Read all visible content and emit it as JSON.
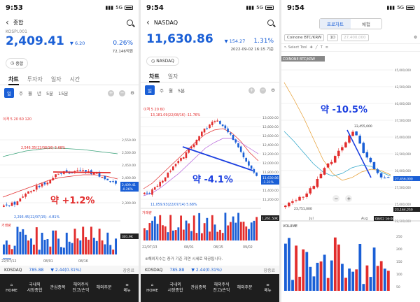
{
  "colors": {
    "up": "#e22d2d",
    "down": "#1a5fd6",
    "trend": "#1b3fe0"
  },
  "panel1": {
    "time": "9:53",
    "network": "5G",
    "title": "종합",
    "code": "KOSPI.001",
    "price": "2,409.41",
    "change": "▼ 6.20",
    "change_pct": "0.26%",
    "volume": "72,146억원",
    "chip": "종합",
    "tabs": [
      "차트",
      "투자자",
      "일자",
      "시간"
    ],
    "periods": [
      "일",
      "주",
      "월",
      "년",
      "5분",
      "15분"
    ],
    "legend": "이격 5 20 60 120",
    "high_label": "2,546.35(22/08/16) 5.68%",
    "low_label": "2,293.45(22/07/15) -4.81%",
    "current_tag": "2,409.41",
    "current_pct": "-0.26%",
    "vol_tag": "301.9K",
    "vol_label": "거래량",
    "price_axis": [
      "2,550.00",
      "2,500.00",
      "2,450.00",
      "2,400.00",
      "2,350.00",
      "2,300.00"
    ],
    "dates": [
      "22/07/12",
      "08/01",
      "08/16"
    ],
    "annotation": "약 +1.2%",
    "ticker": {
      "name": "KOSDAQ",
      "value": "785.88",
      "chg": "▼ 2.44(0.31%)",
      "more": "장종료"
    },
    "nav": [
      "HOME",
      "국내외\n시장종합",
      "관심종목",
      "해외주식\n잔고/손익",
      "해외주문",
      "메뉴"
    ]
  },
  "panel2": {
    "time": "9:54",
    "network": "5G",
    "title": "NASDAQ",
    "price": "11,630.86",
    "change": "▼ 154.27",
    "change_pct": "1.31%",
    "datetime": "2022-09-02 16:15 기준",
    "chip": "NASDAQ",
    "tabs": [
      "차트",
      "일자"
    ],
    "periods": [
      "일",
      "주",
      "월",
      "5분"
    ],
    "legend": "이격 5 20 60",
    "high_label": "13,181.09(22/08/16) -11.76%",
    "low_label": "11,059.93(22/07/14) 5.68%",
    "current_tag": "11,630.86",
    "current_pct": "-1.31%",
    "vol_tag": "1,261.50K",
    "vol_label": "거래량",
    "price_axis": [
      "13,000.00",
      "12,800.00",
      "12,600.00",
      "12,400.00",
      "12,200.00",
      "12,000.00",
      "11,800.00",
      "11,600.00",
      "11,400.00",
      "11,200.00"
    ],
    "dates": [
      "22/07/13",
      "08/01",
      "08/15",
      "09/02"
    ],
    "annotation": "약 -4.1%",
    "note": "※해외지수는 증거 기준 지연 시세로 제공됩니다.",
    "ticker": {
      "name": "KOSDAQ",
      "value": "785.88",
      "chg": "▼ 2.44(0.31%)",
      "more": "장종료"
    },
    "nav": [
      "HOME",
      "국내외\n시장종합",
      "관심종목",
      "해외주식\n잔고/손익",
      "해외주문",
      "메뉴"
    ]
  },
  "panel3": {
    "time": "9:54",
    "network": "5G",
    "seg": [
      "프로차트",
      "체험"
    ],
    "symbol": "Coinone BTC/KRW",
    "interval": "1D",
    "price_box": "27,400,000",
    "tools": "Select Tool",
    "series_label": "COINONE BTC/KRW",
    "high_label": "33,455,000",
    "low_label": "23,751,000",
    "current_tag": "27,456,000",
    "low_tag": "23,164,259",
    "vol_label": "VOLUME",
    "price_axis": [
      "45,000,000",
      "42,500,000",
      "40,000,000",
      "37,500,000",
      "35,000,000",
      "32,500,000",
      "30,000,000",
      "27,500,000",
      "25,000,000",
      "22,500,000"
    ],
    "vol_axis": [
      "250",
      "200",
      "150",
      "100",
      "50"
    ],
    "dates": [
      "Jul",
      "Aug"
    ],
    "date_tag": "08/02 16:00",
    "annotation": "약 -10.5%"
  }
}
